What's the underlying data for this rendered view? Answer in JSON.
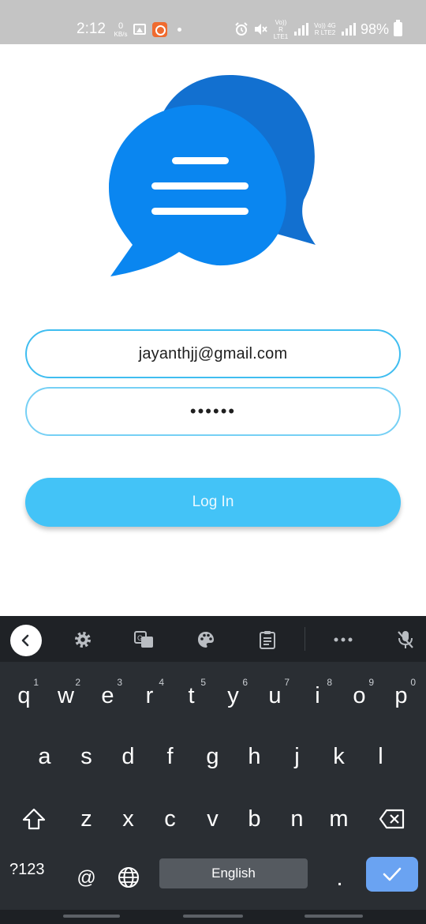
{
  "status_bar": {
    "time": "2:12",
    "speed_value": "0",
    "speed_unit": "KB/s",
    "sim1": "Vo)) R LTE1",
    "sim2": "Vo)) 4G R LTE2",
    "battery": "98%",
    "icons": [
      "gallery-icon",
      "app-notification-icon",
      "alarm-icon",
      "mute-icon",
      "signal-icon",
      "battery-icon"
    ]
  },
  "login": {
    "email_value": "jayanthjj@gmail.com",
    "password_value": "••••••",
    "login_label": "Log In"
  },
  "colors": {
    "accent": "#43c3f7",
    "logo_front": "#0a86f0",
    "logo_back": "#1270d0",
    "keyboard_bg": "#2a2e33",
    "enter_key": "#6aa3f2"
  },
  "keyboard": {
    "toolbar_icons": [
      "back-icon",
      "settings-icon",
      "translate-icon",
      "theme-icon",
      "clipboard-icon",
      "more-icon",
      "mic-off-icon"
    ],
    "row1": [
      "q",
      "w",
      "e",
      "r",
      "t",
      "y",
      "u",
      "i",
      "o",
      "p"
    ],
    "row1_hints": [
      "1",
      "2",
      "3",
      "4",
      "5",
      "6",
      "7",
      "8",
      "9",
      "0"
    ],
    "row2": [
      "a",
      "s",
      "d",
      "f",
      "g",
      "h",
      "j",
      "k",
      "l"
    ],
    "row3": [
      "z",
      "x",
      "c",
      "v",
      "b",
      "n",
      "m"
    ],
    "symbols_label": "?123",
    "at_label": "@",
    "space_label": "English",
    "period_label": "."
  }
}
